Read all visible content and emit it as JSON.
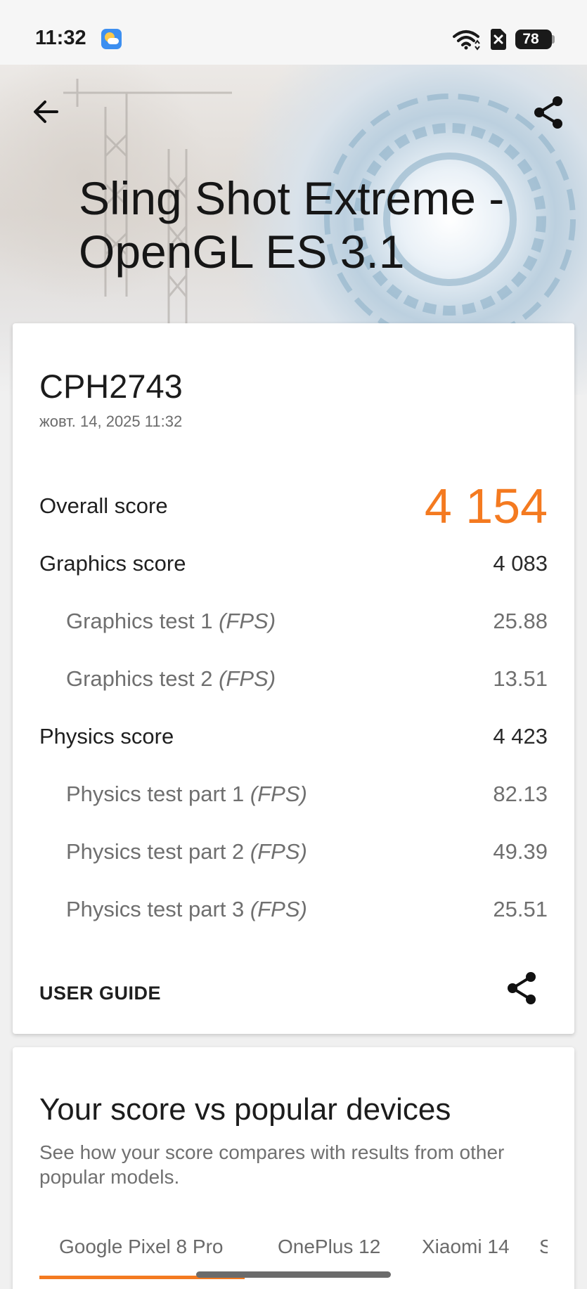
{
  "status_bar": {
    "time": "11:32",
    "battery": "78",
    "icons": [
      "weather-icon",
      "wifi-icon",
      "no-sim-icon",
      "battery-icon"
    ]
  },
  "header": {
    "title": "Sling Shot Extreme - OpenGL ES 3.1",
    "back_icon": "arrow-left-icon",
    "share_icon": "share-icon"
  },
  "result": {
    "device": "CPH2743",
    "date": "жовт. 14, 2025 11:32",
    "overall_label": "Overall score",
    "overall_value": "4 154",
    "rows": [
      {
        "label": "Graphics score",
        "suffix": "",
        "value": "4 083",
        "sub": false
      },
      {
        "label": "Graphics test 1 ",
        "suffix": "(FPS)",
        "value": "25.88",
        "sub": true
      },
      {
        "label": "Graphics test 2 ",
        "suffix": "(FPS)",
        "value": "13.51",
        "sub": true
      },
      {
        "label": "Physics score",
        "suffix": "",
        "value": "4 423",
        "sub": false
      },
      {
        "label": "Physics test part 1 ",
        "suffix": "(FPS)",
        "value": "82.13",
        "sub": true
      },
      {
        "label": "Physics test part 2 ",
        "suffix": "(FPS)",
        "value": "49.39",
        "sub": true
      },
      {
        "label": "Physics test part 3 ",
        "suffix": "(FPS)",
        "value": "25.51",
        "sub": true
      }
    ],
    "user_guide": "USER GUIDE"
  },
  "compare": {
    "title": "Your score vs popular devices",
    "subtitle": "See how your score compares with results from other popular models.",
    "tabs": [
      "Google Pixel 8 Pro",
      "OnePlus 12",
      "Xiaomi 14",
      "S"
    ],
    "active_tab": 0
  },
  "colors": {
    "accent": "#f47a20",
    "text": "#1f1f1f",
    "muted": "#6f6f6f"
  }
}
